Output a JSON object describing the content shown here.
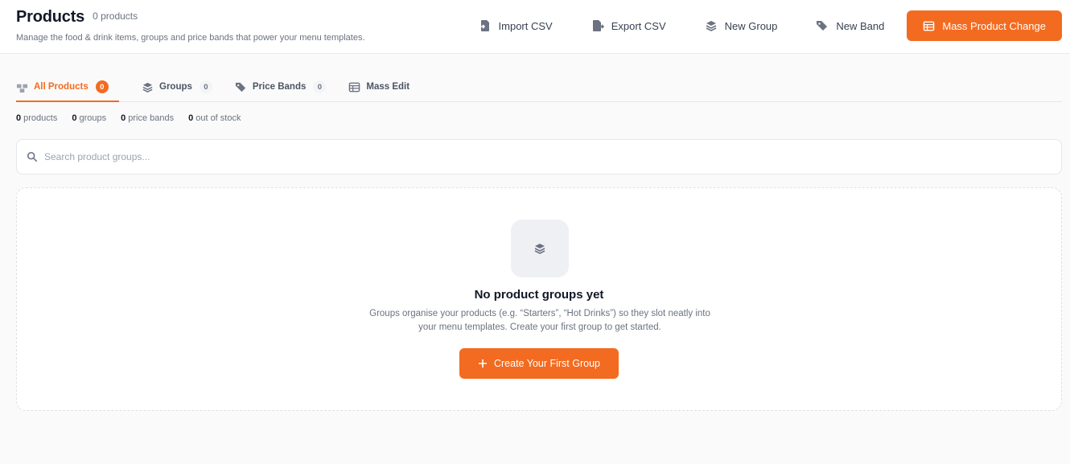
{
  "header": {
    "title": "Products",
    "count": "0 products",
    "subtitle": "Manage the food & drink items, groups and price bands that power your menu templates.",
    "actions": {
      "import_label": "Import CSV",
      "export_label": "Export CSV",
      "new_group_label": "New Group",
      "new_band_label": "New Band",
      "mass_change_label": "Mass Product Change"
    }
  },
  "tabs": [
    {
      "label": "All Products",
      "badge": "0",
      "active": true,
      "icon": "boxes-icon"
    },
    {
      "label": "Groups",
      "badge": "0",
      "active": false,
      "icon": "layers-icon"
    },
    {
      "label": "Price Bands",
      "badge": "0",
      "active": false,
      "icon": "tags-icon"
    },
    {
      "label": "Mass Edit",
      "badge": null,
      "active": false,
      "icon": "table-icon"
    }
  ],
  "stats": [
    {
      "value": "0",
      "label": "products"
    },
    {
      "value": "0",
      "label": "groups"
    },
    {
      "value": "0",
      "label": "price bands"
    },
    {
      "value": "0",
      "label": "out of stock"
    }
  ],
  "search": {
    "placeholder": "Search product groups..."
  },
  "empty_state": {
    "title": "No product groups yet",
    "description": "Groups organise your products (e.g. “Starters”, “Hot Drinks”) so they slot neatly into your menu templates. Create your first group to get started.",
    "button_label": "Create Your First Group"
  },
  "colors": {
    "accent": "#f36b21",
    "text": "#111827",
    "muted": "#6b7280",
    "background": "#fafafa"
  }
}
